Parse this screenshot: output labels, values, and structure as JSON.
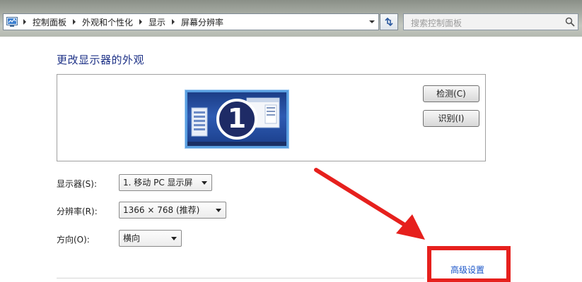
{
  "address_bar": {
    "breadcrumbs": [
      "控制面板",
      "外观和个性化",
      "显示",
      "屏幕分辨率"
    ]
  },
  "search": {
    "placeholder": "搜索控制面板"
  },
  "main": {
    "title": "更改显示器的外观",
    "monitor_number": "1",
    "detect_label": "检测(C)",
    "identify_label": "识别(I)",
    "display": {
      "label": "显示器(S):",
      "value": "1. 移动 PC 显示屏"
    },
    "resolution": {
      "label": "分辨率(R):",
      "value": "1366 × 768 (推荐)"
    },
    "orientation": {
      "label": "方向(O):",
      "value": "横向"
    },
    "advanced_link": "高级设置"
  },
  "colors": {
    "title": "#1e3287",
    "link": "#1a55c8",
    "annotation": "#e6201d",
    "monitor_border": "#5a9fe0"
  },
  "icons": [
    "control-panel-icon",
    "refresh-icon",
    "search-icon",
    "dropdown-arrow-icon"
  ]
}
